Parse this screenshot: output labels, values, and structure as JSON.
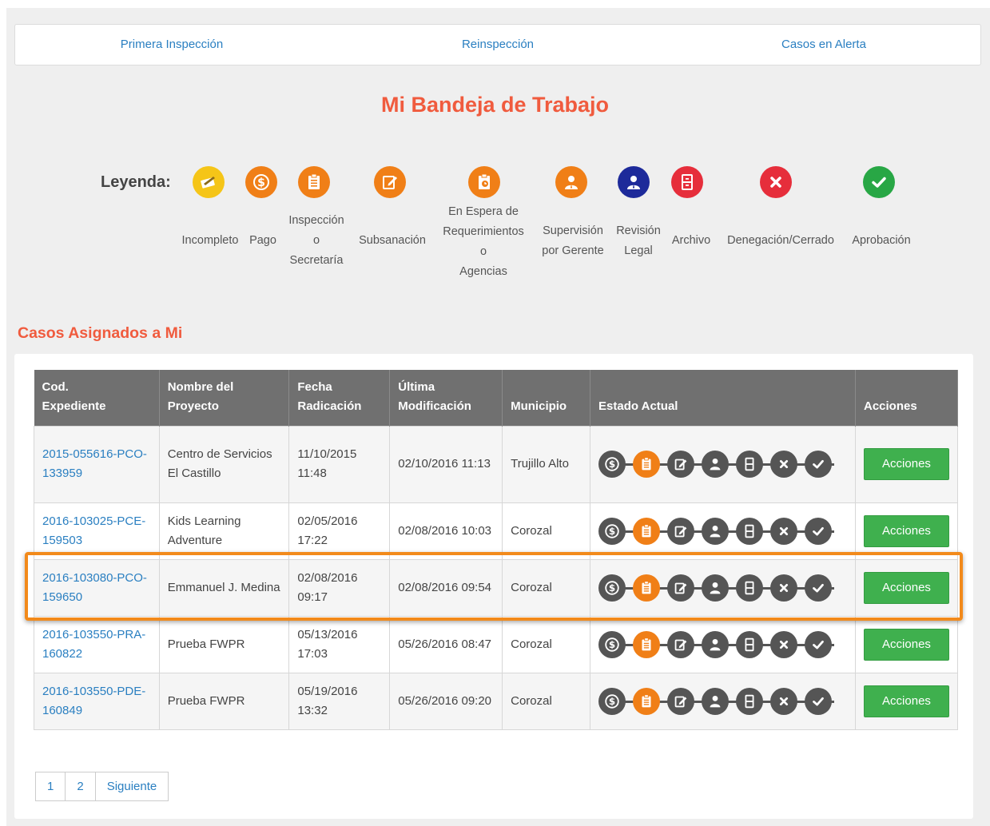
{
  "nav": {
    "tabs": [
      {
        "label": "Primera Inspección"
      },
      {
        "label": "Reinspección"
      },
      {
        "label": "Casos en Alerta"
      }
    ]
  },
  "title": "Mi Bandeja de Trabajo",
  "legend": {
    "label": "Leyenda:",
    "items": [
      {
        "icon": "pencil-paper-icon",
        "color": "#f5c518",
        "label": "Incompleto"
      },
      {
        "icon": "dollar-icon",
        "color": "#f07f17",
        "label": "Pago"
      },
      {
        "icon": "clipboard-icon",
        "color": "#f07f17",
        "label": "Inspección\no\nSecretaría"
      },
      {
        "icon": "edit-icon",
        "color": "#f07f17",
        "label": "Subsanación"
      },
      {
        "icon": "clipboard-clock-icon",
        "color": "#f07f17",
        "label": "En Espera de\nRequerimientos\no\nAgencias"
      },
      {
        "icon": "manager-icon",
        "color": "#f07f17",
        "label": "Supervisión\npor Gerente"
      },
      {
        "icon": "manager-icon",
        "color": "#1d2a9a",
        "label": "Revisión\nLegal"
      },
      {
        "icon": "archive-icon",
        "color": "#e62e3b",
        "label": "Archivo"
      },
      {
        "icon": "x-icon",
        "color": "#e62e3b",
        "label": "Denegación/Cerrado"
      },
      {
        "icon": "check-icon",
        "color": "#28a745",
        "label": "Aprobación"
      }
    ]
  },
  "section_title": "Casos Asignados a Mi",
  "table": {
    "headers": [
      "Cod.\nExpediente",
      "Nombre del\nProyecto",
      "Fecha\nRadicación",
      "Última\nModificación",
      "Municipio",
      "Estado Actual",
      "Acciones"
    ],
    "rows": [
      {
        "code": "2015-055616-PCO-133959",
        "project": "Centro de Servicios El Castillo",
        "radicacion": "11/10/2015 11:48",
        "modificacion": "02/10/2016 11:13",
        "municipio": "Trujillo Alto",
        "estado": "Inspección o Secretaría",
        "action": "Acciones"
      },
      {
        "code": "2016-103025-PCE-159503",
        "project": "Kids Learning Adventure",
        "radicacion": "02/05/2016 17:22",
        "modificacion": "02/08/2016 10:03",
        "municipio": "Corozal",
        "estado": "Inspección o Secretaría",
        "action": "Acciones"
      },
      {
        "code": "2016-103080-PCO-159650",
        "project": "Emmanuel J. Medina",
        "radicacion": "02/08/2016 09:17",
        "modificacion": "02/08/2016 09:54",
        "municipio": "Corozal",
        "estado": "Inspección o Secretaría",
        "action": "Acciones"
      },
      {
        "code": "2016-103550-PRA-160822",
        "project": "Prueba FWPR",
        "radicacion": "05/13/2016 17:03",
        "modificacion": "05/26/2016 08:47",
        "municipio": "Corozal",
        "estado": "Inspección o Secretaría",
        "action": "Acciones"
      },
      {
        "code": "2016-103550-PDE-160849",
        "project": "Prueba FWPR",
        "radicacion": "05/19/2016 13:32",
        "modificacion": "05/26/2016 09:20",
        "municipio": "Corozal",
        "estado": "Inspección o Secretaría",
        "action": "Acciones"
      }
    ]
  },
  "pagination": {
    "pages": [
      "1",
      "2"
    ],
    "next": "Siguiente"
  }
}
